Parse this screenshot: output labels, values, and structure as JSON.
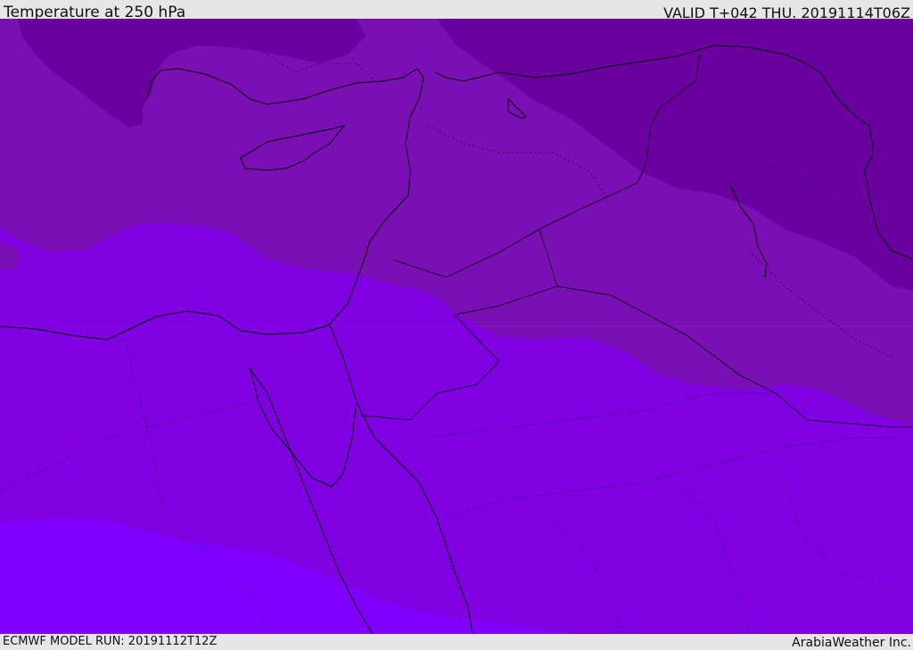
{
  "header": {
    "title": "Temperature at 250 hPa",
    "valid_time": "VALID T+042 THU. 20191114T06Z"
  },
  "footer": {
    "model_run": "ECMWF MODEL RUN: 20191112T12Z",
    "credit": "ArabiaWeather Inc."
  },
  "colors": {
    "band_coldest": "#6a009f",
    "band_cold": "#7a0fb3",
    "band_mid": "#7f00e0",
    "band_warm": "#8000ff",
    "boundary_line": "#000000"
  }
}
